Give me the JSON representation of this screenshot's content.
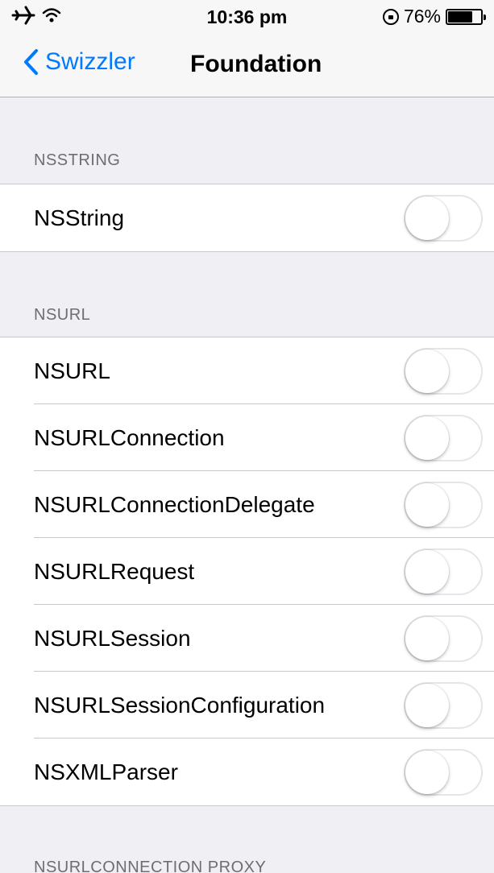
{
  "status_bar": {
    "time": "10:36 pm",
    "battery_percent": "76%",
    "battery_level": 0.76
  },
  "nav": {
    "back_label": "Swizzler",
    "title": "Foundation"
  },
  "sections": [
    {
      "header": "NSSTRING",
      "items": [
        {
          "label": "NSString",
          "on": false
        }
      ]
    },
    {
      "header": "NSURL",
      "items": [
        {
          "label": "NSURL",
          "on": false
        },
        {
          "label": "NSURLConnection",
          "on": false
        },
        {
          "label": "NSURLConnectionDelegate",
          "on": false
        },
        {
          "label": "NSURLRequest",
          "on": false
        },
        {
          "label": "NSURLSession",
          "on": false
        },
        {
          "label": "NSURLSessionConfiguration",
          "on": false
        },
        {
          "label": "NSXMLParser",
          "on": false
        }
      ]
    },
    {
      "header": "NSURLCONNECTION PROXY",
      "items": []
    }
  ],
  "colors": {
    "accent": "#007aff",
    "background": "#efeff4"
  }
}
